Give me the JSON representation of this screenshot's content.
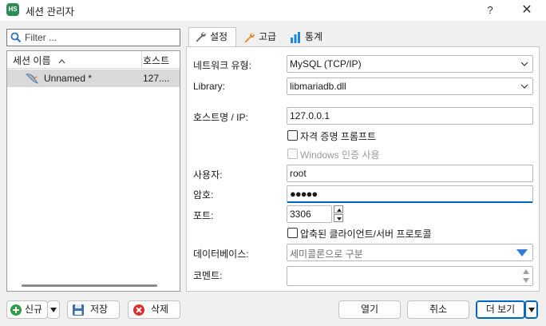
{
  "window": {
    "app_icon_text": "HS",
    "title": "세션 관리자",
    "help": "?",
    "close": "✕"
  },
  "filter": {
    "placeholder": "Filter ...",
    "value": ""
  },
  "sessions": {
    "headers": {
      "name": "세션 이름",
      "host": "호스트"
    },
    "rows": [
      {
        "name": "Unnamed *",
        "host": "127...."
      }
    ]
  },
  "tabs": [
    {
      "label": "설정",
      "icon": "wrench-icon",
      "active": true
    },
    {
      "label": "고급",
      "icon": "wrench-icon",
      "active": false
    },
    {
      "label": "통계",
      "icon": "bar-chart-icon",
      "active": false
    }
  ],
  "settings": {
    "network_type": {
      "label": "네트워크 유형:",
      "value": "MySQL (TCP/IP)"
    },
    "library": {
      "label": "Library:",
      "value": "libmariadb.dll"
    },
    "host": {
      "label": "호스트명 / IP:",
      "value": "127.0.0.1"
    },
    "prompt_credentials": {
      "label": "자격 증명 프롬프트",
      "checked": false,
      "enabled": true
    },
    "windows_auth": {
      "label": "Windows 인증 사용",
      "checked": false,
      "enabled": false
    },
    "user": {
      "label": "사용자:",
      "value": "root"
    },
    "password": {
      "label": "암호:",
      "value": "●●●●●"
    },
    "port": {
      "label": "포트:",
      "value": "3306"
    },
    "compressed": {
      "label": "압축된 클라이언트/서버 프로토콜",
      "checked": false,
      "enabled": true
    },
    "databases": {
      "label": "데이터베이스:",
      "placeholder": "세미콜론으로 구분"
    },
    "comment": {
      "label": "코멘트:",
      "value": ""
    }
  },
  "buttons": {
    "new": "신규",
    "save": "저장",
    "delete": "삭제",
    "open": "열기",
    "cancel": "취소",
    "more": "더 보기"
  },
  "colors": {
    "accent": "#0067c0",
    "new_icon": "#2e9e45",
    "delete_icon": "#e02b2b",
    "dropdown_arrow": "#2b7fd6"
  }
}
